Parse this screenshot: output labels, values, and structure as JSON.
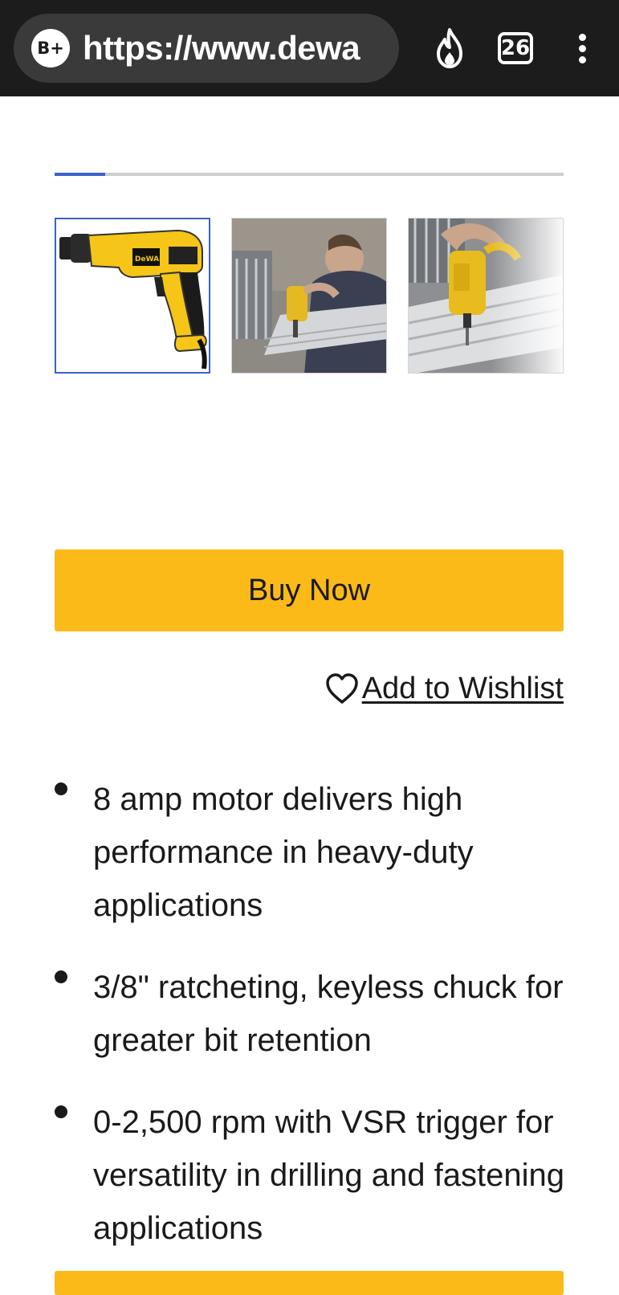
{
  "browser": {
    "url": "https://www.dewa",
    "site_badge": "B+",
    "tab_count": "26",
    "icons": [
      "site-info-icon",
      "flame-icon",
      "tabs-icon",
      "more-menu-icon"
    ]
  },
  "carousel": {
    "progress": 0.1,
    "thumbnails": [
      {
        "name": "drill-product-thumbnail",
        "selected": true
      },
      {
        "name": "drill-in-use-thumbnail",
        "selected": false
      },
      {
        "name": "drill-closeup-thumbnail",
        "selected": false
      }
    ]
  },
  "actions": {
    "buy_label": "Buy Now",
    "wishlist_label": "Add to Wishlist"
  },
  "features": [
    "8 amp motor delivers high performance in heavy-duty applications",
    "3/8\" ratcheting, keyless chuck for greater bit retention",
    "0-2,500 rpm with VSR trigger for versatility in drilling and fastening applications"
  ],
  "colors": {
    "accent": "#fcba19",
    "selection": "#3a63c9",
    "topbar": "#1c1c1c"
  }
}
